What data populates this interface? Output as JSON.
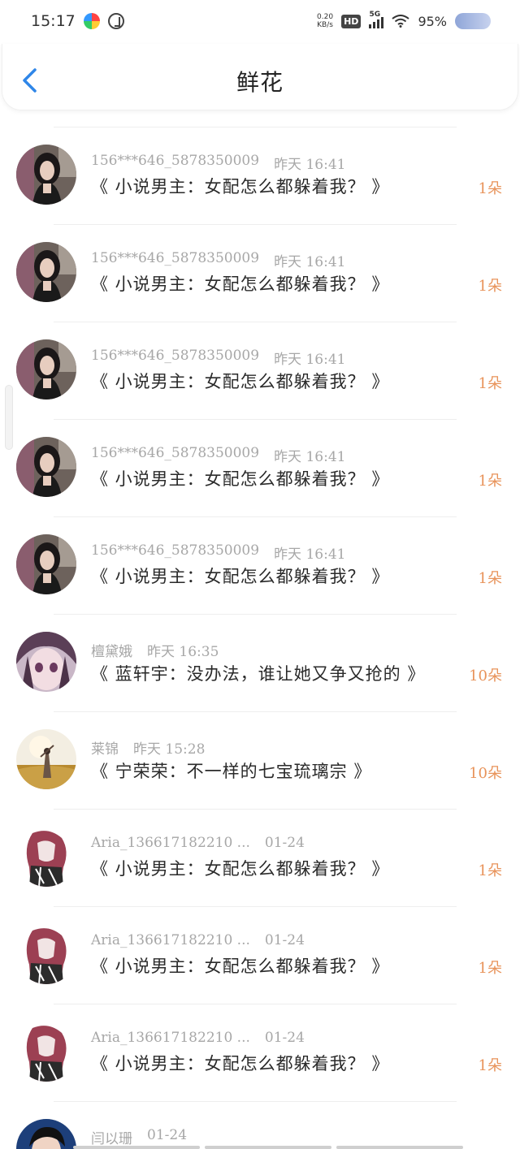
{
  "status_bar": {
    "time": "15:17",
    "net_speed_value": "0.20",
    "net_speed_unit": "KB/s",
    "hd": "HD",
    "network": "5G",
    "battery": "95%",
    "icons": [
      "app-icon-1",
      "app-icon-2",
      "hd-icon",
      "signal-icon",
      "wifi-icon",
      "battery-icon"
    ]
  },
  "header": {
    "title": "鲜花",
    "back_icon": "chevron-left-icon",
    "accent_color": "#2f86e8"
  },
  "colors": {
    "count": "#e8935a",
    "meta": "#a7a7a7"
  },
  "items": [
    {
      "user": "156***646_5878350009",
      "time": "昨天 16:41",
      "book": "《 小说男主：女配怎么都躲着我？ 》",
      "count": "1朵",
      "avatar": "portrait-dark-hair"
    },
    {
      "user": "156***646_5878350009",
      "time": "昨天 16:41",
      "book": "《 小说男主：女配怎么都躲着我？ 》",
      "count": "1朵",
      "avatar": "portrait-dark-hair"
    },
    {
      "user": "156***646_5878350009",
      "time": "昨天 16:41",
      "book": "《 小说男主：女配怎么都躲着我？ 》",
      "count": "1朵",
      "avatar": "portrait-dark-hair"
    },
    {
      "user": "156***646_5878350009",
      "time": "昨天 16:41",
      "book": "《 小说男主：女配怎么都躲着我？ 》",
      "count": "1朵",
      "avatar": "portrait-dark-hair"
    },
    {
      "user": "156***646_5878350009",
      "time": "昨天 16:41",
      "book": "《 小说男主：女配怎么都躲着我？ 》",
      "count": "1朵",
      "avatar": "portrait-dark-hair"
    },
    {
      "user": "檀黛娥",
      "time": "昨天 16:35",
      "book": "《 蓝轩宇：没办法，谁让她又争又抢的 》",
      "count": "10朵",
      "avatar": "anime-girl-purple"
    },
    {
      "user": "莱锦",
      "time": "昨天 15:28",
      "book": "《 宁荣荣：不一样的七宝琉璃宗 》",
      "count": "10朵",
      "avatar": "field-sunset"
    },
    {
      "user": "Aria_136617182210 ...",
      "time": "01-24",
      "book": "《 小说男主：女配怎么都躲着我？ 》",
      "count": "1朵",
      "avatar": "anime-ink-sketch"
    },
    {
      "user": "Aria_136617182210 ...",
      "time": "01-24",
      "book": "《 小说男主：女配怎么都躲着我？ 》",
      "count": "1朵",
      "avatar": "anime-ink-sketch"
    },
    {
      "user": "Aria_136617182210 ...",
      "time": "01-24",
      "book": "《 小说男主：女配怎么都躲着我？ 》",
      "count": "1朵",
      "avatar": "anime-ink-sketch"
    },
    {
      "user": "闫以珊",
      "time": "01-24",
      "book": "",
      "count": "",
      "avatar": "portrait-blue"
    }
  ]
}
